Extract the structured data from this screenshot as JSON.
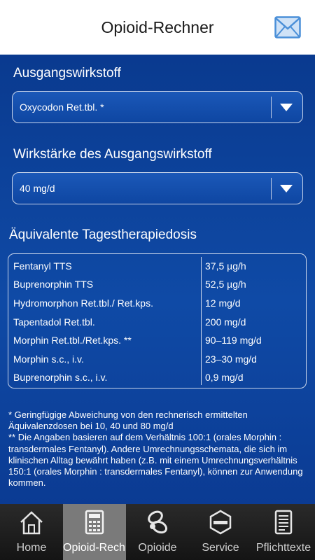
{
  "header": {
    "title": "Opioid-Rechner",
    "mail_icon": "envelope-icon"
  },
  "form": {
    "source_label": "Ausgangswirkstoff",
    "source_value": "Oxycodon Ret.tbl. *",
    "strength_label": "Wirkstärke des Ausgangswirkstoff",
    "strength_value": "40 mg/d"
  },
  "results": {
    "title": "Äquivalente Tagestherapiedosis",
    "rows": [
      {
        "name": "Fentanyl TTS",
        "dose": "37,5 µg/h"
      },
      {
        "name": "Buprenorphin TTS",
        "dose": "52,5 µg/h"
      },
      {
        "name": "Hydromorphon Ret.tbl./ Ret.kps.",
        "dose": "12 mg/d"
      },
      {
        "name": "Tapentadol Ret.tbl.",
        "dose": "200 mg/d"
      },
      {
        "name": "Morphin Ret.tbl./Ret.kps. **",
        "dose": "90–119 mg/d"
      },
      {
        "name": "Morphin s.c., i.v.",
        "dose": "23–30 mg/d"
      },
      {
        "name": "Buprenorphin s.c., i.v.",
        "dose": "0,9 mg/d"
      }
    ]
  },
  "footnotes": [
    "* Geringfügige Abweichung von den rechnerisch ermittelten Äquivalenzdosen bei 10, 40 und 80 mg/d",
    "** Die Angaben basieren auf dem Verhältnis 100:1 (orales Morphin : transdermales Fentanyl). Andere Umrechnungsschemata, die sich im klinischen Alltag bewährt haben (z.B. mit einem Umrechnungsverhältnis 150:1 (orales Morphin : transdermales Fentanyl), können zur Anwendung kommen."
  ],
  "tabs": [
    {
      "label": "Home",
      "icon": "home-icon",
      "active": false
    },
    {
      "label": "Opioid-Rechner",
      "icon": "calculator-icon",
      "active": true
    },
    {
      "label": "Opioide",
      "icon": "pills-icon",
      "active": false
    },
    {
      "label": "Service",
      "icon": "hexal-logo-icon",
      "active": false
    },
    {
      "label": "Pflichttexte",
      "icon": "document-icon",
      "active": false
    }
  ],
  "colors": {
    "background": "#0d3f95",
    "header": "#ffffff",
    "border": "#c8d4ea",
    "tabbar": "#1e1e1e",
    "tab_active": "#7a7a7a",
    "mail_icon": "#4a8fd8"
  }
}
